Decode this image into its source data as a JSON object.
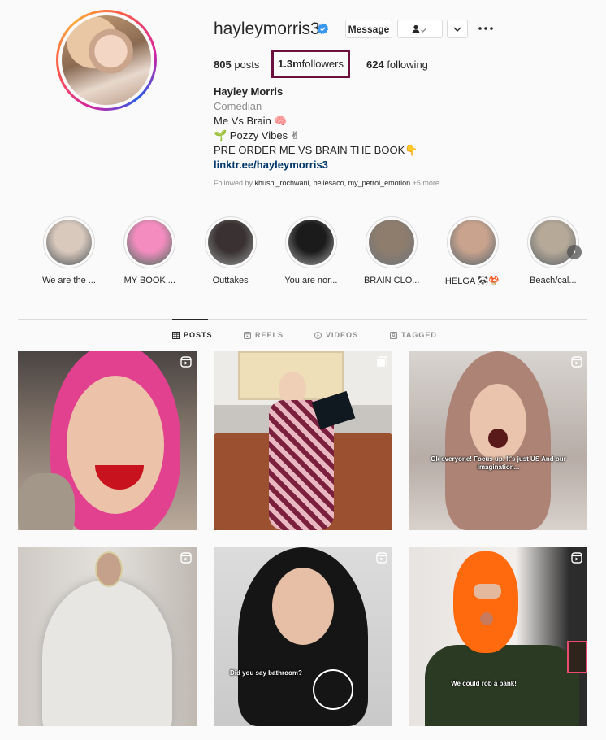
{
  "profile": {
    "username": "hayleymorris3",
    "verified": true,
    "message_label": "Message",
    "stats": {
      "posts_count": "805",
      "posts_label": " posts",
      "followers_count": "1.3m",
      "followers_label": " followers",
      "following_count": "624",
      "following_label": " following"
    },
    "bio": {
      "name": "Hayley Morris",
      "category": "Comedian",
      "line1": "Me Vs Brain 🧠",
      "line2": "🌱 Pozzy Vibes ✌",
      "line3": "PRE ORDER ME VS BRAIN THE BOOK👇",
      "link": "linktr.ee/hayleymorris3"
    },
    "followed_by": {
      "prefix": "Followed by ",
      "names": "khushi_rochwani, bellesaco, my_petrol_emotion",
      "more": " +5 more"
    }
  },
  "highlights": [
    {
      "label": "We are the ...",
      "color": "#d9c9bd"
    },
    {
      "label": "MY BOOK ...",
      "color": "#f48cc0"
    },
    {
      "label": "Outtakes",
      "color": "#3a3232"
    },
    {
      "label": "You are nor...",
      "color": "#1b1b1b"
    },
    {
      "label": "BRAIN CLO...",
      "color": "#8e7d6d"
    },
    {
      "label": "HELGA 🐼🍄",
      "color": "#c9a38d"
    },
    {
      "label": "Beach/cal...",
      "color": "#b6a998"
    }
  ],
  "tabs": [
    {
      "label": "POSTS",
      "active": true
    },
    {
      "label": "REELS",
      "active": false
    },
    {
      "label": "VIDEOS",
      "active": false
    },
    {
      "label": "TAGGED",
      "active": false
    }
  ],
  "posts": [
    {
      "type": "reel",
      "caption": ""
    },
    {
      "type": "carousel",
      "caption": ""
    },
    {
      "type": "reel",
      "caption": "Ok everyone! Focus up. It's just US And our imagination..."
    },
    {
      "type": "reel",
      "caption": ""
    },
    {
      "type": "reel",
      "caption": "Did you say bathroom?"
    },
    {
      "type": "reel",
      "caption": "We could rob a bank!"
    }
  ],
  "colors": {
    "followers_highlight_border": "#6c1040",
    "link": "#00376b",
    "verified_badge": "#3897f0"
  }
}
